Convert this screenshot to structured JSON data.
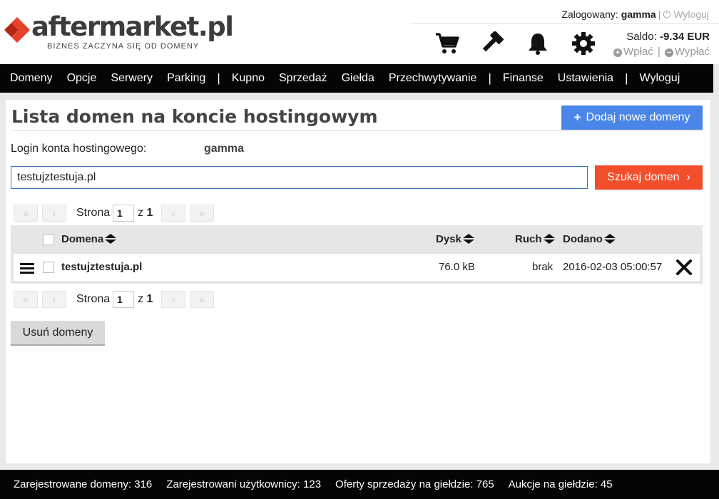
{
  "header": {
    "logo_text": "aftermarket.pl",
    "tagline": "BIZNES ZACZYNA SIĘ OD DOMENY",
    "logged_label": "Zalogowany:",
    "username": "gamma",
    "logout_label": "Wyloguj",
    "saldo_label": "Saldo:",
    "saldo_value": "-9.34 EUR",
    "deposit_label": "Wpłać",
    "withdraw_label": "Wypłać",
    "icons": [
      "cart-icon",
      "gavel-icon",
      "bell-icon",
      "gear-icon"
    ]
  },
  "nav": {
    "items": [
      "Domeny",
      "Opcje",
      "Serwery",
      "Parking",
      "Kupno",
      "Sprzedaż",
      "Giełda",
      "Przechwytywanie",
      "Finanse",
      "Ustawienia",
      "Wyloguj"
    ]
  },
  "main": {
    "title": "Lista domen na koncie hostingowym",
    "add_button": "Dodaj nowe domeny",
    "login_label": "Login konta hostingowego:",
    "login_value": "gamma",
    "search_value": "testujztestuja.pl",
    "search_button": "Szukaj domen",
    "pager": {
      "label": "Strona",
      "current": "1",
      "of_label": "z",
      "total": "1"
    },
    "table": {
      "headers": {
        "domain": "Domena",
        "disk": "Dysk",
        "traffic": "Ruch",
        "added": "Dodano"
      },
      "rows": [
        {
          "domain": "testujztestuja.pl",
          "disk": "76.0 kB",
          "traffic": "brak",
          "added": "2016-02-03 05:00:57"
        }
      ]
    },
    "delete_button": "Usuń domeny"
  },
  "footer": {
    "registered_domains": "Zarejestrowane domeny: 316",
    "registered_users": "Zarejestrowani użytkownicy: 123",
    "offers": "Oferty sprzedaży na giełdzie: 765",
    "auctions": "Aukcje na giełdzie: 45"
  },
  "colors": {
    "brand_red": "#e8412b",
    "add_blue": "#4a86e8",
    "search_orange": "#f24e2b",
    "nav_bg": "#050505"
  }
}
